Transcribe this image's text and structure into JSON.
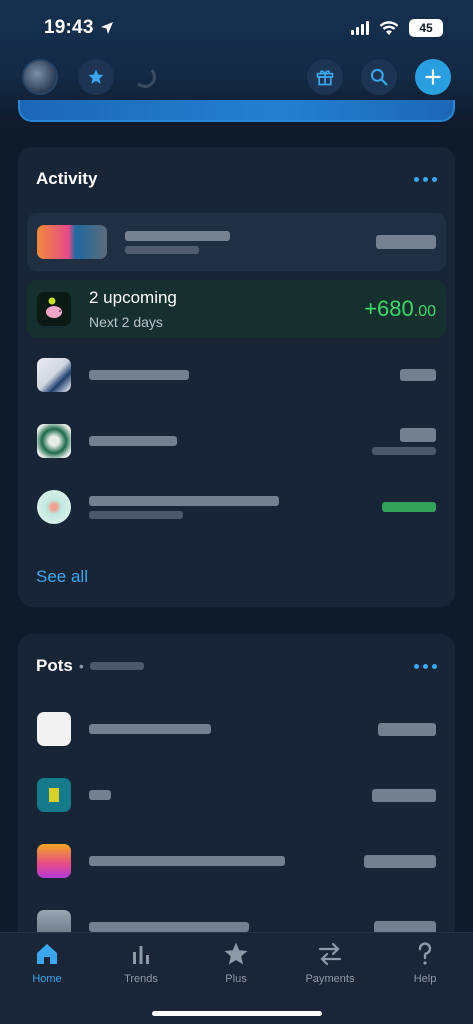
{
  "status_bar": {
    "time": "19:43",
    "battery": "45"
  },
  "activity": {
    "title": "Activity",
    "upcoming": {
      "title": "2 upcoming",
      "subtitle": "Next 2 days",
      "amount_main": "+680",
      "amount_decimal": ".00"
    },
    "see_all": "See all"
  },
  "pots": {
    "title": "Pots"
  },
  "tabs": [
    {
      "label": "Home"
    },
    {
      "label": "Trends"
    },
    {
      "label": "Plus"
    },
    {
      "label": "Payments"
    },
    {
      "label": "Help"
    }
  ],
  "colors": {
    "accent": "#3aa7ee",
    "positive": "#3ed96b",
    "background": "#0f1a2b",
    "card": "#182537"
  },
  "icons": [
    "location-arrow-icon",
    "star-icon",
    "loading-spinner-icon",
    "gift-icon",
    "search-icon",
    "plus-icon",
    "piggy-bank-icon",
    "home-icon",
    "trends-icon",
    "payments-icon",
    "help-icon"
  ]
}
